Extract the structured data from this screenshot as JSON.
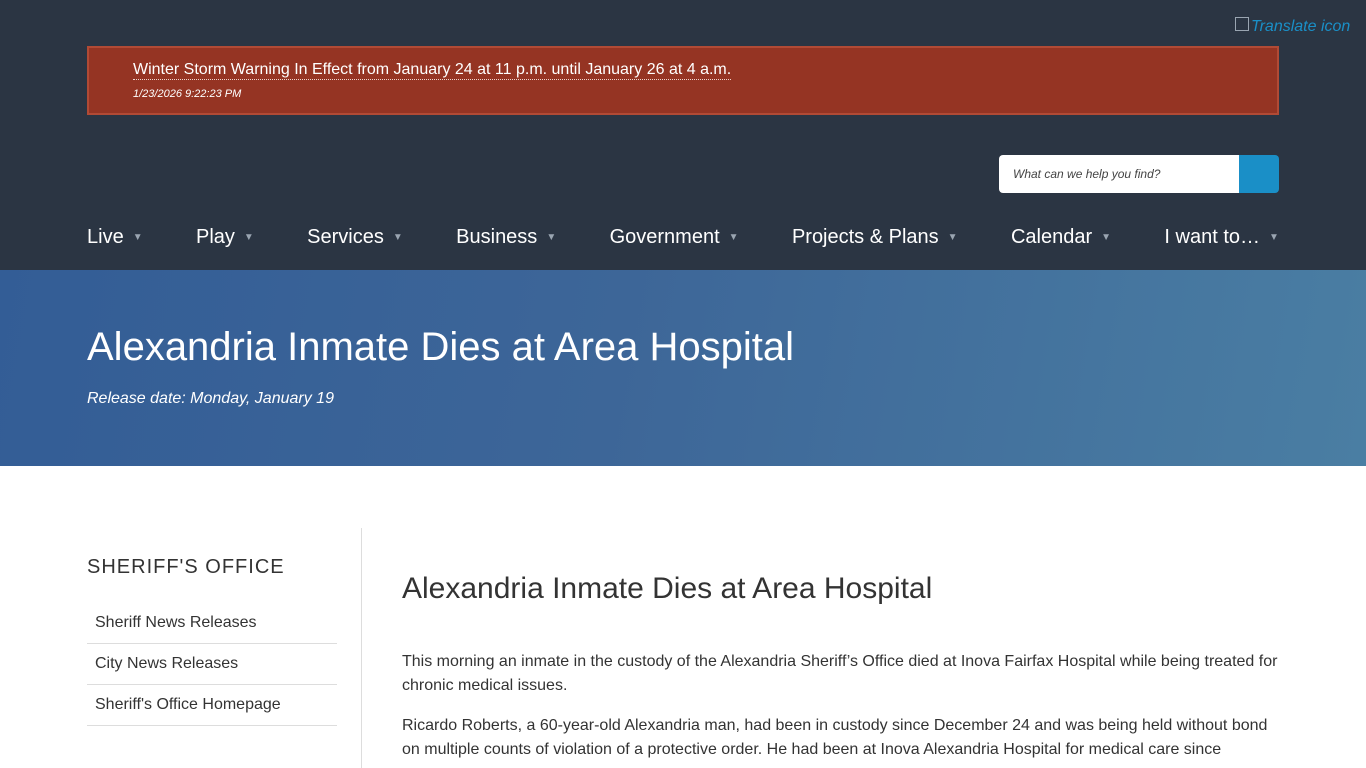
{
  "header": {
    "translate_alt": "Translate icon",
    "alert": {
      "title": "Winter Storm Warning In Effect from January 24 at 11 p.m. until January 26 at 4 a.m.",
      "timestamp": "1/23/2026 9:22:23 PM"
    },
    "search": {
      "placeholder": "What can we help you find?"
    },
    "nav": [
      "Live",
      "Play",
      "Services",
      "Business",
      "Government",
      "Projects & Plans",
      "Calendar",
      "I want to…"
    ]
  },
  "hero": {
    "title": "Alexandria Inmate Dies at Area Hospital",
    "release": "Release date: Monday, January 19"
  },
  "sidebar": {
    "heading": "SHERIFF'S OFFICE",
    "links": [
      "Sheriff News Releases",
      "City News Releases",
      "Sheriff's Office Homepage"
    ]
  },
  "article": {
    "title": "Alexandria Inmate Dies at Area Hospital",
    "paragraphs": [
      "This morning an inmate in the custody of the Alexandria Sheriff’s Office died at Inova Fairfax Hospital while being treated for chronic medical issues.",
      "Ricardo Roberts, a 60-year-old Alexandria man, had been in custody since December 24 and was being held without bond on multiple counts of violation of a protective order. He had been at Inova Alexandria Hospital for medical care since"
    ]
  },
  "colors": {
    "header_bg": "#2b3543",
    "alert_bg": "#953423",
    "accent": "#1a8fc7",
    "hero_start": "#335d96",
    "hero_end": "#4a7ea3"
  }
}
